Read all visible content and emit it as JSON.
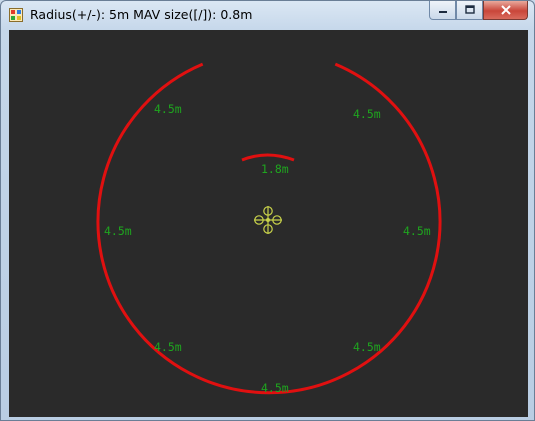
{
  "window": {
    "title": "Radius(+/-): 5m MAV size([/]): 0.8m",
    "app_icon": "app-window-icon",
    "controls": [
      "minimize-icon",
      "maximize-icon",
      "close-icon"
    ]
  },
  "view": {
    "background": "#2a2a2a",
    "arc_color": "#e01010",
    "label_color": "#1fa51f",
    "vehicle_color": "#c8d24a",
    "labels": {
      "top_right": "4.5m",
      "top_left": "4.5m",
      "left": "4.5m",
      "right": "4.5m",
      "bottom_left": "4.5m",
      "bottom_right": "4.5m",
      "bottom": "4.5m",
      "inner": "1.8m"
    }
  }
}
